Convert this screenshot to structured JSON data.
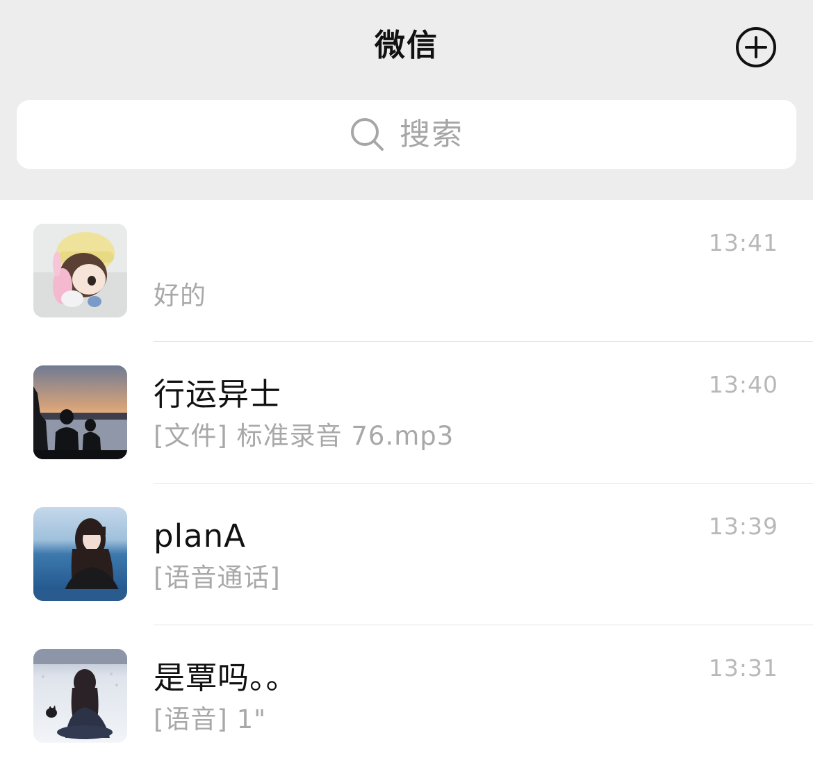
{
  "header": {
    "title": "微信",
    "add_icon": "plus-circle-icon"
  },
  "search": {
    "icon": "search-icon",
    "placeholder": "搜索"
  },
  "chats": [
    {
      "name": "",
      "preview": "好的",
      "time": "13:41",
      "avatar": "avatar-doll-yellow-hat"
    },
    {
      "name": "行运异士",
      "preview": "[文件] 标准录音 76.mp3",
      "time": "13:40",
      "avatar": "avatar-sunset-lake"
    },
    {
      "name": "planA",
      "preview": "[语音通话]",
      "time": "13:39",
      "avatar": "avatar-girl-sea"
    },
    {
      "name": "是覃吗。。",
      "preview": "[语音] 1\"",
      "time": "13:31",
      "avatar": "avatar-girl-snow-cat"
    }
  ],
  "colors": {
    "header_bg": "#ededed",
    "list_bg": "#ffffff",
    "title": "#111111",
    "secondary_text": "#a8a8a8",
    "time_text": "#b8b8b8",
    "divider": "#e5e5e5"
  }
}
